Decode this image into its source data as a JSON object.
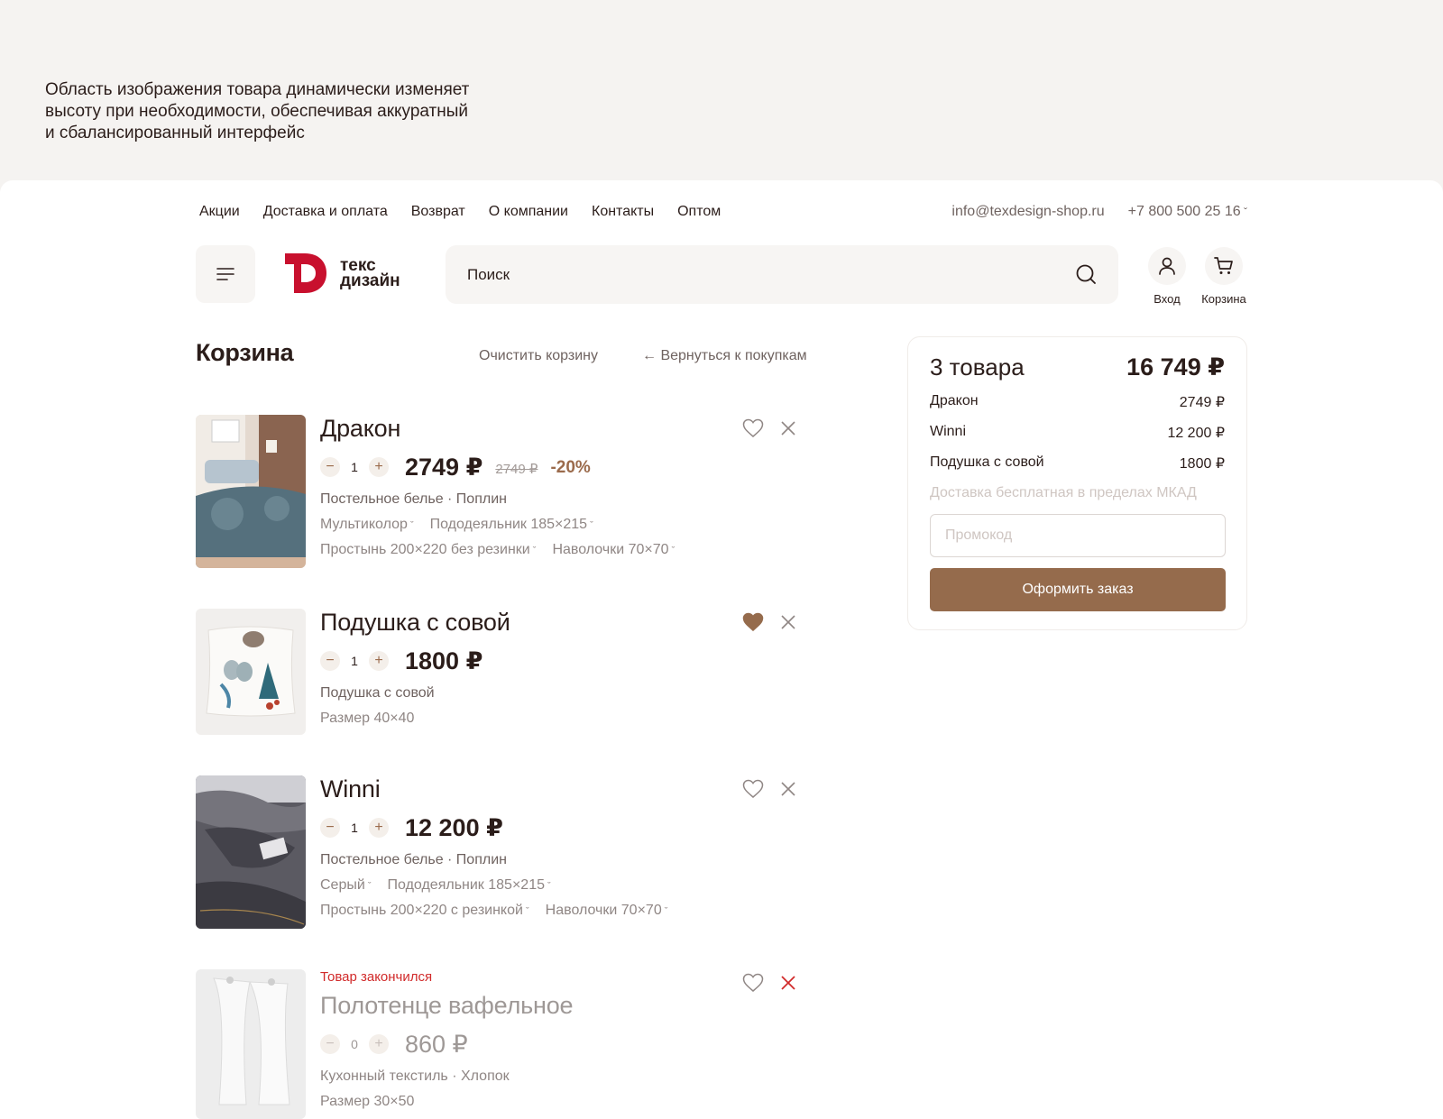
{
  "note": {
    "line1": "Область изображения товара динамически изменяет",
    "line2": "высоту при необходимости, обеспечивая аккуратный",
    "line3": "и сбалансированный интерфейс"
  },
  "topnav": [
    "Акции",
    "Доставка и оплата",
    "Возврат",
    "О компании",
    "Контакты",
    "Оптом"
  ],
  "contacts": {
    "email": "info@texdesign-shop.ru",
    "phone": "+7 800 500 25 16"
  },
  "logo": {
    "line1": "текс",
    "line2": "дизайн"
  },
  "search": {
    "placeholder": "Поиск"
  },
  "header_actions": {
    "login": "Вход",
    "cart": "Корзина"
  },
  "cart": {
    "title": "Корзина",
    "clear": "Очистить корзину",
    "back": "← Вернуться к покупкам",
    "items": [
      {
        "name": "Дракон",
        "qty": "1",
        "price": "2749 ₽",
        "old_price": "2749 ₽",
        "discount": "-20%",
        "meta": "Постельное белье · Поплин",
        "opts1": [
          "Мультиколор",
          "Пододеяльник 185×215"
        ],
        "opts2": [
          "Простынь 200×220 без резинки",
          "Наволочки 70×70"
        ],
        "favorite": false
      },
      {
        "name": "Подушка с совой",
        "qty": "1",
        "price": "1800 ₽",
        "meta": "Подушка с совой",
        "size": "Размер 40×40",
        "favorite": true
      },
      {
        "name": "Winni",
        "qty": "1",
        "price": "12 200 ₽",
        "meta": "Постельное белье · Поплин",
        "opts1": [
          "Серый",
          "Пододеяльник 185×215"
        ],
        "opts2": [
          "Простынь 200×220 с резинкой",
          "Наволочки 70×70"
        ],
        "favorite": false
      },
      {
        "status": "Товар закончился",
        "name": "Полотенце вафельное",
        "qty": "0",
        "price": "860 ₽",
        "meta": "Кухонный текстиль · Хлопок",
        "size": "Размер 30×50",
        "favorite": false
      }
    ]
  },
  "summary": {
    "count": "3 товара",
    "total": "16 749 ₽",
    "lines": [
      {
        "name": "Дракон",
        "price": "2749 ₽"
      },
      {
        "name": "Winni",
        "price": "12 200 ₽"
      },
      {
        "name": "Подушка с совой",
        "price": "1800 ₽"
      }
    ],
    "delivery": "Доставка бесплатная в пределах МКАД",
    "promo_placeholder": "Промокод",
    "order_button": "Оформить заказ"
  },
  "colors": {
    "brand": "#c8102e",
    "accent": "#956b4c",
    "soldout": "#d12a2a"
  },
  "icons": [
    "menu-icon",
    "search-icon",
    "user-icon",
    "cart-icon",
    "heart-icon",
    "close-icon"
  ]
}
